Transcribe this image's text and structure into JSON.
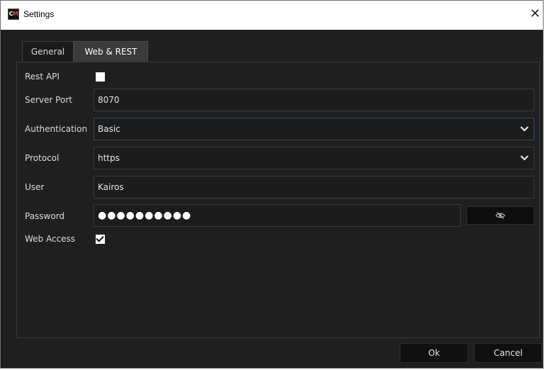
{
  "window": {
    "title": "Settings",
    "logo_text_c": "C",
    "logo_text_m": "M",
    "close_glyph": "✕"
  },
  "tabs": [
    {
      "label": "General",
      "active": false
    },
    {
      "label": "Web & REST",
      "active": true
    }
  ],
  "form": {
    "rest_api": {
      "label": "Rest API",
      "checked": false
    },
    "server_port": {
      "label": "Server Port",
      "value": "8070"
    },
    "authentication": {
      "label": "Authentication",
      "value": "Basic"
    },
    "protocol": {
      "label": "Protocol",
      "value": "https"
    },
    "user": {
      "label": "User",
      "value": "Kairos"
    },
    "password": {
      "label": "Password",
      "masked_value": "●●●●●●●●●●",
      "toggle_icon": "eye-slash-icon"
    },
    "web_access": {
      "label": "Web Access",
      "checked": true
    }
  },
  "footer": {
    "ok_label": "Ok",
    "cancel_label": "Cancel"
  },
  "colors": {
    "background": "#1f1f1f",
    "field_bg": "#1c1c1c",
    "active_tab": "#3b3b3b",
    "focus_border": "#2f4d6b",
    "title_bar": "#ffffff"
  }
}
